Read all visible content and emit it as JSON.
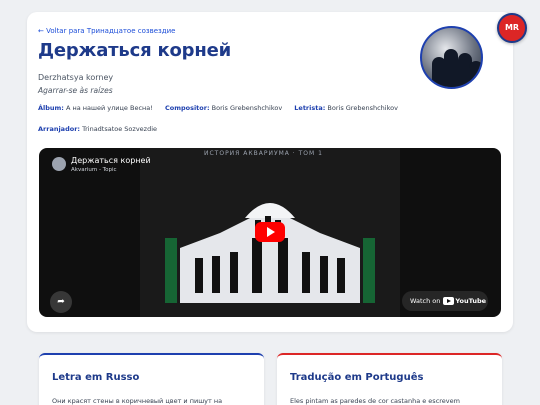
{
  "header": {
    "back_link": "← Voltar para Тринадцатое созвездие",
    "title": "Держаться корней",
    "transliteration": "Derzhatsya korney",
    "translation": "Agarrar-se às raízes"
  },
  "meta": {
    "album_label": "Álbum:",
    "album_value": "А на нашей улице Весна!",
    "composer_label": "Compositor:",
    "composer_value": "Boris Grebenshchikov",
    "lyricist_label": "Letrista:",
    "lyricist_value": "Boris Grebenshchikov",
    "arranger_label": "Arranjador:",
    "arranger_value": "Trinadtsatoe Sozvezdie"
  },
  "video": {
    "title": "Держаться корней",
    "channel": "Akvarium - Topic",
    "thumb_caption": "ИСТОРИЯ АКВАРИУМА · ТОМ 1",
    "watch_on": "Watch on",
    "youtube": "YouTube"
  },
  "panels": {
    "russian_title": "Letra em Russo",
    "russian_text": "Они красят стены в коричневый цвет и пишут на",
    "portuguese_title": "Tradução em Português",
    "portuguese_text": "Eles pintam as paredes de cor castanha e escrevem"
  },
  "badge": {
    "text": "MR"
  },
  "colors": {
    "accent": "#1e40af",
    "title": "#1e3a8a",
    "red": "#dc2626"
  }
}
